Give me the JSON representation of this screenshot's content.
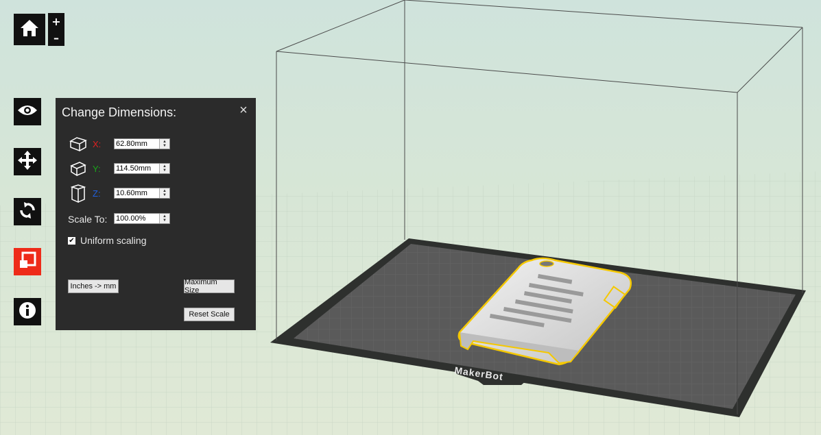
{
  "colors": {
    "panel_bg": "#2b2b2b",
    "active_tool": "#ee2b19",
    "axis_x": "#e02020",
    "axis_y": "#1aa81a",
    "axis_z": "#2060e0",
    "model_outline": "#f5c800",
    "platform": "#555555"
  },
  "toolbar": {
    "home_icon": "home-icon",
    "zoom_in": "+",
    "zoom_out": "–",
    "items": [
      {
        "icon": "eye-icon",
        "name": "look"
      },
      {
        "icon": "move-icon",
        "name": "move"
      },
      {
        "icon": "rotate-icon",
        "name": "turn"
      },
      {
        "icon": "scale-icon",
        "name": "scale",
        "active": true
      },
      {
        "icon": "info-icon",
        "name": "object-info"
      }
    ]
  },
  "panel": {
    "title": "Change Dimensions:",
    "close_icon": "×",
    "x_label": "X:",
    "x_value": "62.80mm",
    "y_label": "Y:",
    "y_value": "114.50mm",
    "z_label": "Z:",
    "z_value": "10.60mm",
    "scale_label": "Scale To:",
    "scale_value": "100.00%",
    "uniform_checked": "✔",
    "uniform_label": "Uniform scaling",
    "inches_button": "Inches -> mm",
    "max_size_button": "Maximum Size",
    "reset_scale_button": "Reset Scale"
  },
  "scene": {
    "brand_logo": "MakerBot"
  }
}
